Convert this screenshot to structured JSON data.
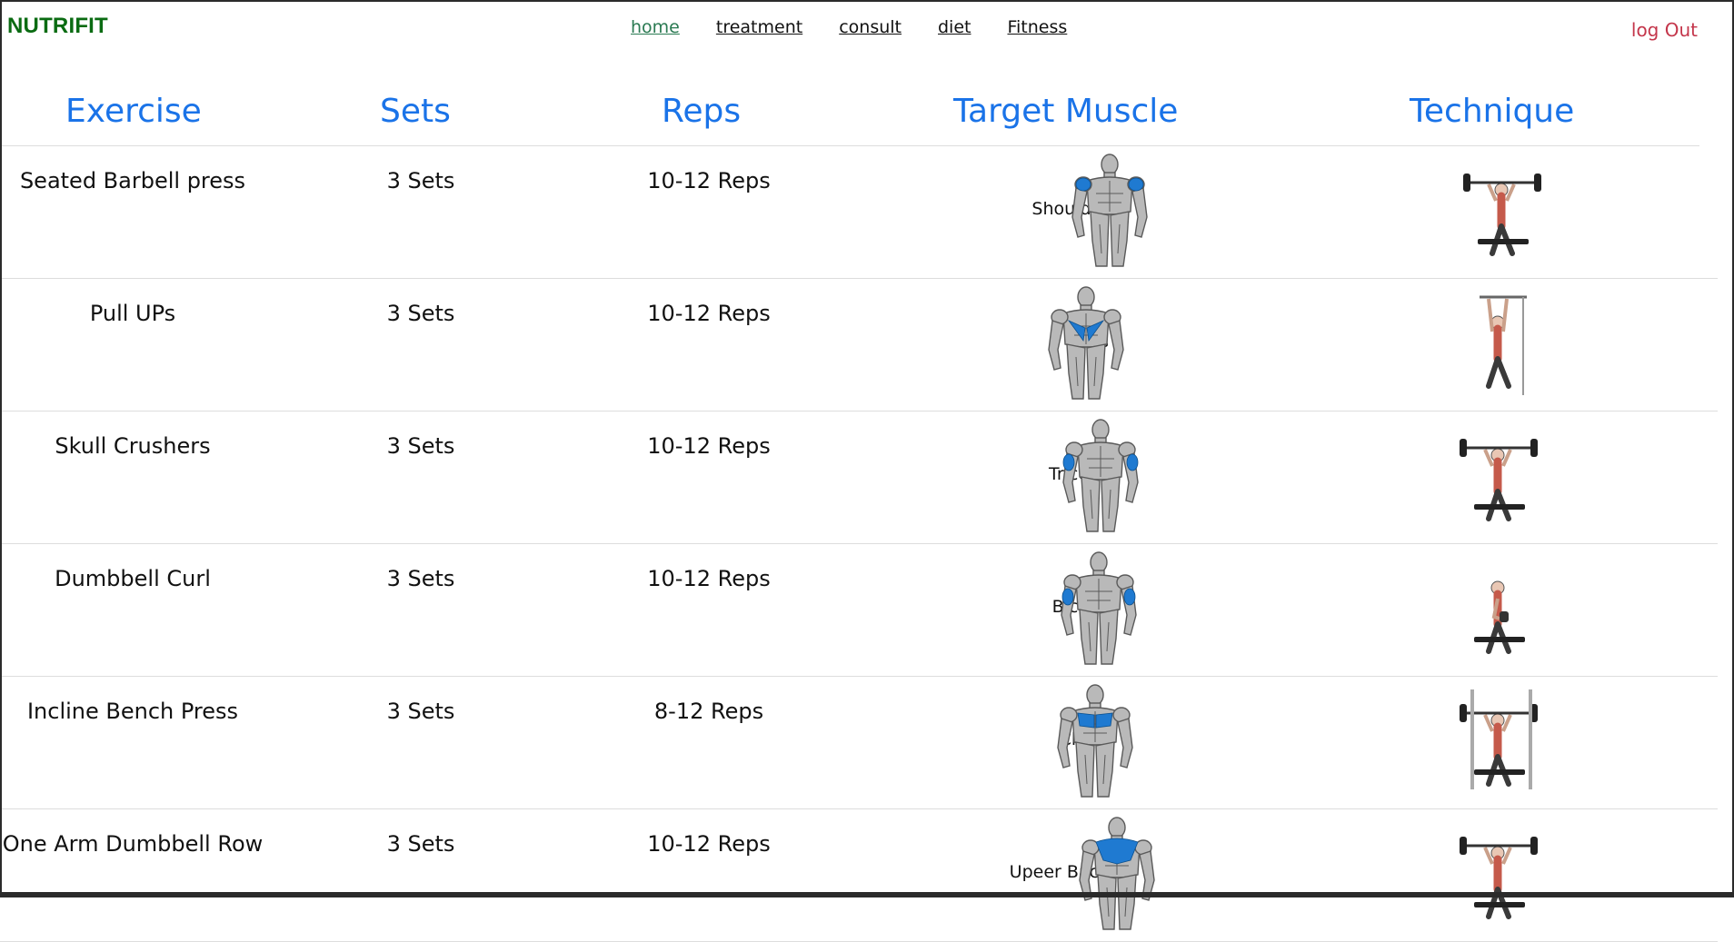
{
  "app": {
    "brand": "NUTRIFIT",
    "logout": "log Out"
  },
  "nav": {
    "home": "home",
    "treatment": "treatment",
    "consult": "consult",
    "diet": "diet",
    "fitness": "Fitness"
  },
  "table": {
    "headers": [
      "Exercise",
      "Sets",
      "Reps",
      "Target Muscle",
      "Technique"
    ],
    "rows": [
      {
        "exercise": "Seated Barbell press",
        "sets": "3 Sets",
        "reps": "10-12 Reps",
        "muscle": "Shoulder",
        "highlight": "shoulders",
        "technique": "barbell-press"
      },
      {
        "exercise": "Pull UPs",
        "sets": "3 Sets",
        "reps": "10-12 Reps",
        "muscle": "Lats",
        "highlight": "lats",
        "technique": "pull-up"
      },
      {
        "exercise": "Skull Crushers",
        "sets": "3 Sets",
        "reps": "10-12 Reps",
        "muscle": "Triceps",
        "highlight": "triceps",
        "technique": "skull-crusher"
      },
      {
        "exercise": "Dumbbell Curl",
        "sets": "3 Sets",
        "reps": "10-12 Reps",
        "muscle": "Biceps",
        "highlight": "biceps",
        "technique": "dumbbell-curl"
      },
      {
        "exercise": "Incline Bench Press",
        "sets": "3 Sets",
        "reps": "8-12 Reps",
        "muscle": "Chest",
        "highlight": "chest",
        "technique": "incline-bench"
      },
      {
        "exercise": "One Arm Dumbbell Row",
        "sets": "3 Sets",
        "reps": "10-12 Reps",
        "muscle": "Upeer Back",
        "highlight": "upper-back",
        "technique": "dumbbell-row"
      }
    ]
  },
  "colors": {
    "brand": "#0a6b12",
    "header": "#1a73e8",
    "logout": "#c4364b",
    "highlight": "#1f7ad1"
  }
}
